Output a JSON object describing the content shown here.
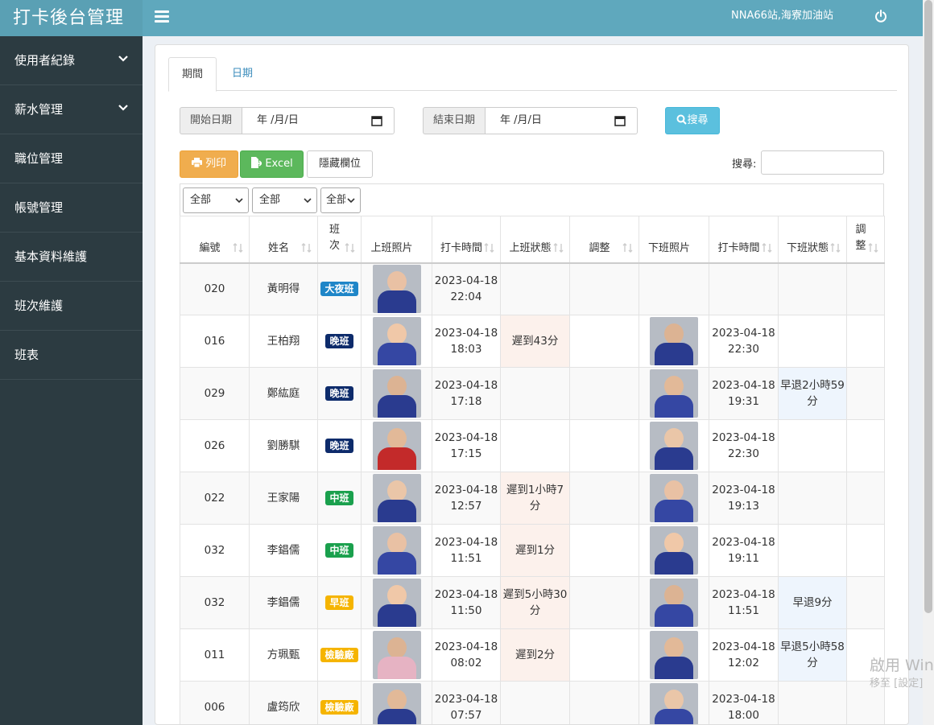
{
  "app": {
    "title": "打卡後台管理",
    "station": "NNA66站,海寮加油站"
  },
  "sidebar": {
    "items": [
      {
        "label": "使用者紀錄",
        "expandable": true
      },
      {
        "label": "薪水管理",
        "expandable": true
      },
      {
        "label": "職位管理",
        "expandable": false
      },
      {
        "label": "帳號管理",
        "expandable": false
      },
      {
        "label": "基本資料維護",
        "expandable": false
      },
      {
        "label": "班次維護",
        "expandable": false
      },
      {
        "label": "班表",
        "expandable": false
      }
    ]
  },
  "tabs": [
    {
      "label": "期間",
      "active": true
    },
    {
      "label": "日期",
      "active": false
    }
  ],
  "filters": {
    "start_label": "開始日期",
    "end_label": "結束日期",
    "date_placeholder": "年 /月/日",
    "search_button": "搜尋"
  },
  "toolbar": {
    "print": "列印",
    "excel": "Excel",
    "hide_columns": "隱藏欄位",
    "search_label": "搜尋:"
  },
  "column_filters": [
    "全部",
    "全部",
    "全部"
  ],
  "columns": [
    "編號",
    "姓名",
    "班次",
    "上班照片",
    "打卡時間",
    "上班狀態",
    "調整",
    "下班照片",
    "打卡時間",
    "下班狀態",
    "調整"
  ],
  "shift_colors": {
    "大夜班": "#1f86c8",
    "晚班": "#0d2b6b",
    "中班": "#1aa04d",
    "早班": "#f5b400",
    "檢驗廠": "#f5b400"
  },
  "rows": [
    {
      "id": "020",
      "name": "黃明得",
      "shift": "大夜班",
      "in_date": "2023-04-18",
      "in_time": "22:04",
      "in_status": "",
      "out_photo": false,
      "out_date": "",
      "out_time": "",
      "out_status": ""
    },
    {
      "id": "016",
      "name": "王柏翔",
      "shift": "晚班",
      "in_date": "2023-04-18",
      "in_time": "18:03",
      "in_status": "遲到43分",
      "out_photo": true,
      "out_date": "2023-04-18",
      "out_time": "22:30",
      "out_status": ""
    },
    {
      "id": "029",
      "name": "鄭紘庭",
      "shift": "晚班",
      "in_date": "2023-04-18",
      "in_time": "17:18",
      "in_status": "",
      "out_photo": true,
      "out_date": "2023-04-18",
      "out_time": "19:31",
      "out_status": "早退2小時59分"
    },
    {
      "id": "026",
      "name": "劉勝騏",
      "shift": "晚班",
      "in_date": "2023-04-18",
      "in_time": "17:15",
      "in_status": "",
      "out_photo": true,
      "out_date": "2023-04-18",
      "out_time": "22:30",
      "out_status": ""
    },
    {
      "id": "022",
      "name": "王家陽",
      "shift": "中班",
      "in_date": "2023-04-18",
      "in_time": "12:57",
      "in_status": "遲到1小時7分",
      "out_photo": true,
      "out_date": "2023-04-18",
      "out_time": "19:13",
      "out_status": ""
    },
    {
      "id": "032",
      "name": "李錩儒",
      "shift": "中班",
      "in_date": "2023-04-18",
      "in_time": "11:51",
      "in_status": "遲到1分",
      "out_photo": true,
      "out_date": "2023-04-18",
      "out_time": "19:11",
      "out_status": ""
    },
    {
      "id": "032",
      "name": "李錩儒",
      "shift": "早班",
      "in_date": "2023-04-18",
      "in_time": "11:50",
      "in_status": "遲到5小時30分",
      "out_photo": true,
      "out_date": "2023-04-18",
      "out_time": "11:51",
      "out_status": "早退9分"
    },
    {
      "id": "011",
      "name": "方珮甄",
      "shift": "檢驗廠",
      "in_date": "2023-04-18",
      "in_time": "08:02",
      "in_status": "遲到2分",
      "out_photo": true,
      "out_date": "2023-04-18",
      "out_time": "12:02",
      "out_status": "早退5小時58分"
    },
    {
      "id": "006",
      "name": "盧筠欣",
      "shift": "檢驗廠",
      "in_date": "2023-04-18",
      "in_time": "07:57",
      "in_status": "",
      "out_photo": true,
      "out_date": "2023-04-18",
      "out_time": "18:00",
      "out_status": ""
    }
  ],
  "watermark": {
    "line1": "啟用 Win",
    "line2": "移至 [設定] "
  }
}
